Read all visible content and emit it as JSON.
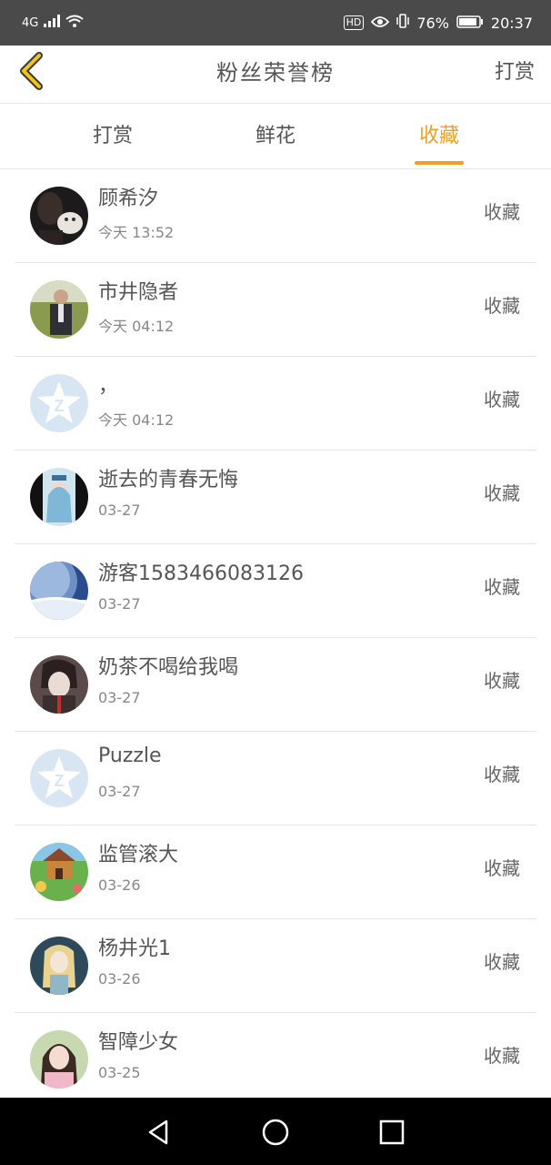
{
  "status_bar": {
    "network": "4G",
    "hd": "HD",
    "battery_percent": "76%",
    "time": "20:37"
  },
  "header": {
    "back_icon": "chevron-left-icon",
    "title": "粉丝荣誉榜",
    "action_label": "打赏"
  },
  "tabs": [
    {
      "label": "打赏",
      "active": false
    },
    {
      "label": "鲜花",
      "active": false
    },
    {
      "label": "收藏",
      "active": true
    }
  ],
  "colors": {
    "accent": "#f0a020",
    "text": "#555555",
    "subtext": "#888888"
  },
  "fans": [
    {
      "name": "顾希汐",
      "time": "今天 13:52",
      "action": "收藏",
      "avatar": "photo-girl-with-dog"
    },
    {
      "name": "市井隐者",
      "time": "今天 04:12",
      "action": "收藏",
      "avatar": "photo-man-in-field"
    },
    {
      "name": "，",
      "time": "今天 04:12",
      "action": "收藏",
      "avatar": "default-star-z"
    },
    {
      "name": "逝去的青春无悔",
      "time": "03-27",
      "action": "收藏",
      "avatar": "photo-anime-portrait"
    },
    {
      "name": "游客1583466083126",
      "time": "03-27",
      "action": "收藏",
      "avatar": "photo-earth-space"
    },
    {
      "name": "奶茶不喝给我喝",
      "time": "03-27",
      "action": "收藏",
      "avatar": "photo-anime-boy"
    },
    {
      "name": "Puzzle",
      "time": "03-27",
      "action": "收藏",
      "avatar": "default-star-z"
    },
    {
      "name": "监管滚大",
      "time": "03-26",
      "action": "收藏",
      "avatar": "photo-cartoon-village"
    },
    {
      "name": "杨井光1",
      "time": "03-26",
      "action": "收藏",
      "avatar": "photo-anime-girl-blonde"
    },
    {
      "name": "智障少女",
      "time": "03-25",
      "action": "收藏",
      "avatar": "photo-girl-portrait"
    }
  ],
  "navbar": {
    "back": "triangle-back-icon",
    "home": "circle-home-icon",
    "recents": "square-recents-icon"
  }
}
